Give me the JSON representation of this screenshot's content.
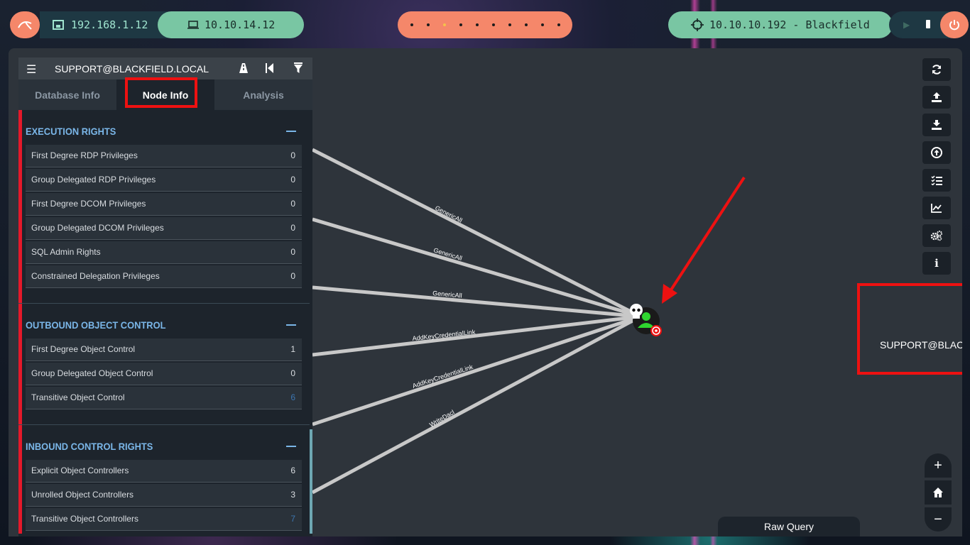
{
  "topbar": {
    "eth_ip": "192.168.1.12",
    "vpn_ip": "10.10.14.12",
    "workspaces": [
      "",
      "",
      "",
      "",
      "",
      "",
      "",
      "",
      "",
      ""
    ],
    "active_workspace": 2,
    "target": "10.10.10.192 - Blackfield"
  },
  "panel": {
    "title": "SUPPORT@BLACKFIELD.LOCAL",
    "tabs": [
      "Database Info",
      "Node Info",
      "Analysis"
    ],
    "active_tab": "Node Info",
    "sections": [
      {
        "title": "EXECUTION RIGHTS",
        "rows": [
          {
            "label": "First Degree RDP Privileges",
            "value": "0"
          },
          {
            "label": "Group Delegated RDP Privileges",
            "value": "0"
          },
          {
            "label": "First Degree DCOM Privileges",
            "value": "0"
          },
          {
            "label": "Group Delegated DCOM Privileges",
            "value": "0"
          },
          {
            "label": "SQL Admin Rights",
            "value": "0"
          },
          {
            "label": "Constrained Delegation Privileges",
            "value": "0"
          }
        ]
      },
      {
        "title": "OUTBOUND OBJECT CONTROL",
        "rows": [
          {
            "label": "First Degree Object Control",
            "value": "1"
          },
          {
            "label": "Group Delegated Object Control",
            "value": "0"
          },
          {
            "label": "Transitive Object Control",
            "value": "6"
          }
        ]
      },
      {
        "title": "INBOUND CONTROL RIGHTS",
        "rows": [
          {
            "label": "Explicit Object Controllers",
            "value": "6"
          },
          {
            "label": "Unrolled Object Controllers",
            "value": "3"
          },
          {
            "label": "Transitive Object Controllers",
            "value": "7"
          }
        ]
      }
    ]
  },
  "graph": {
    "node_label": "SUPPORT@BLACKFIELD.LOCAL",
    "edges": [
      {
        "label": "GenericAll"
      },
      {
        "label": "GenericAll"
      },
      {
        "label": "GenericAll"
      },
      {
        "label": "AddKeyCredentialLink"
      },
      {
        "label": "AddKeyCredentialLink"
      },
      {
        "label": "WriteDacl"
      }
    ]
  },
  "toolbar": {
    "icons": [
      "refresh-icon",
      "upload-icon",
      "download-icon",
      "import-icon",
      "queries-icon",
      "stats-icon",
      "settings-icon",
      "info-icon"
    ]
  },
  "raw_query": {
    "label": "Raw Query"
  },
  "colors": {
    "accent_red": "#e11111",
    "section_blue": "#7ab6e8",
    "pill_salmon": "#f5876a",
    "pill_green": "#79c6a3"
  }
}
